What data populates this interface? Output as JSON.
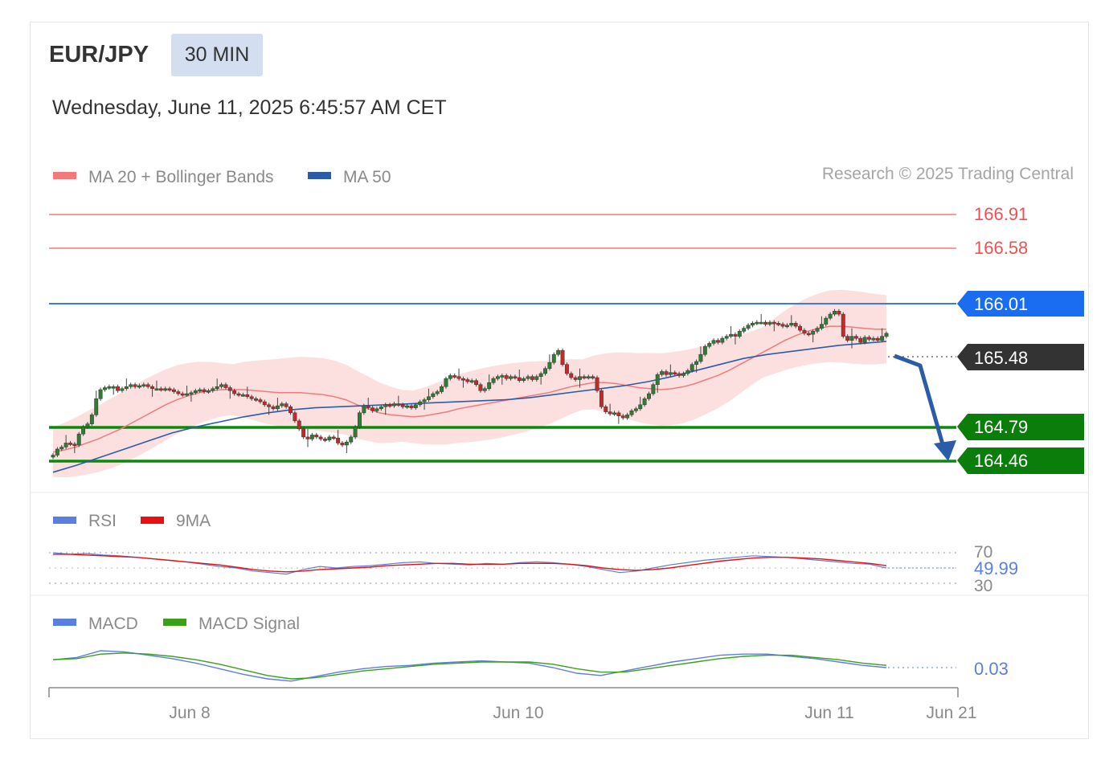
{
  "header": {
    "pair": "EUR/JPY",
    "timeframe": "30 MIN",
    "datetime": "Wednesday, June 11, 2025 6:45:57 AM CET",
    "copyright": "Research © 2025 Trading Central"
  },
  "legend": {
    "price": [
      {
        "label": "MA 20 + Bollinger Bands",
        "color": "#f47a7a"
      },
      {
        "label": "MA 50",
        "color": "#2a5ca8"
      }
    ],
    "rsi": [
      {
        "label": "RSI",
        "color": "#5b7fe0"
      },
      {
        "label": "9MA",
        "color": "#e81010"
      }
    ],
    "macd": [
      {
        "label": "MACD",
        "color": "#5b7fe0"
      },
      {
        "label": "MACD Signal",
        "color": "#3aa01a"
      }
    ]
  },
  "levels": [
    {
      "value": "166.91",
      "style": "resistance-text",
      "color": "#f05050"
    },
    {
      "value": "166.58",
      "style": "resistance-text",
      "color": "#f05050"
    },
    {
      "value": "166.01",
      "style": "pivot-badge",
      "color": "#1a6cf0"
    },
    {
      "value": "165.48",
      "style": "last-price-badge",
      "color": "#333333"
    },
    {
      "value": "164.79",
      "style": "support-badge",
      "color": "#0a7d0a"
    },
    {
      "value": "164.46",
      "style": "support-badge",
      "color": "#0a7d0a"
    }
  ],
  "rsi": {
    "ticks": [
      "70",
      "30"
    ],
    "current": "49.99"
  },
  "macd": {
    "current": "0.03"
  },
  "x_axis": {
    "labels": [
      "Jun 8",
      "Jun 10",
      "Jun 11",
      "Jun 21"
    ]
  },
  "chart_data": {
    "type": "candlestick",
    "ylim": [
      164.3,
      167.05
    ],
    "closes": [
      164.52,
      164.58,
      164.6,
      164.64,
      164.63,
      164.62,
      164.73,
      164.8,
      164.83,
      164.92,
      165.08,
      165.17,
      165.19,
      165.2,
      165.2,
      165.16,
      165.18,
      165.2,
      165.22,
      165.2,
      165.21,
      165.22,
      165.2,
      165.18,
      165.18,
      165.17,
      165.18,
      165.17,
      165.15,
      165.13,
      165.12,
      165.13,
      165.14,
      165.16,
      165.17,
      165.15,
      165.16,
      165.18,
      165.2,
      165.22,
      165.19,
      165.16,
      165.13,
      165.12,
      165.12,
      165.1,
      165.08,
      165.07,
      165.05,
      165.02,
      165,
      164.98,
      165.01,
      165.03,
      165.0,
      164.94,
      164.86,
      164.78,
      164.7,
      164.68,
      164.72,
      164.7,
      164.68,
      164.67,
      164.7,
      164.69,
      164.64,
      164.62,
      164.65,
      164.7,
      164.8,
      164.94,
      165.01,
      164.99,
      164.96,
      164.98,
      165,
      165.02,
      165.01,
      165.03,
      165.02,
      165,
      165.01,
      164.99,
      165.02,
      165.05,
      165.07,
      165.1,
      165.13,
      165.15,
      165.2,
      165.28,
      165.31,
      165.3,
      165.28,
      165.27,
      165.25,
      165.26,
      165.22,
      165.16,
      165.18,
      165.24,
      165.28,
      165.3,
      165.31,
      165.28,
      165.3,
      165.29,
      165.26,
      165.28,
      165.3,
      165.27,
      165.3,
      165.33,
      165.38,
      165.44,
      165.52,
      165.56,
      165.42,
      165.33,
      165.29,
      165.27,
      165.3,
      165.29,
      165.3,
      165.29,
      165.16,
      165.0,
      164.95,
      164.93,
      164.94,
      164.91,
      164.89,
      164.92,
      164.96,
      164.98,
      165.02,
      165.08,
      165.13,
      165.22,
      165.32,
      165.35,
      165.32,
      165.34,
      165.33,
      165.31,
      165.33,
      165.36,
      165.42,
      165.45,
      165.52,
      165.6,
      165.63,
      165.66,
      165.64,
      165.68,
      165.7,
      165.72,
      165.7,
      165.75,
      165.78,
      165.81,
      165.83,
      165.84,
      165.84,
      165.82,
      165.84,
      165.83,
      165.82,
      165.8,
      165.81,
      165.83,
      165.8,
      165.76,
      165.73,
      165.72,
      165.75,
      165.78,
      165.82,
      165.88,
      165.92,
      165.95,
      165.92,
      165.7,
      165.66,
      165.7,
      165.68,
      165.64,
      165.69,
      165.67,
      165.68,
      165.66,
      165.7,
      165.73
    ],
    "ma20": [
      164.55,
      164.57,
      164.6,
      164.64,
      164.68,
      164.73,
      164.78,
      164.84,
      164.9,
      164.96,
      165.02,
      165.07,
      165.11,
      165.14,
      165.16,
      165.17,
      165.17,
      165.17,
      165.16,
      165.15,
      165.14,
      165.14,
      165.14,
      165.13,
      165.12,
      165.1,
      165.07,
      165.02,
      164.98,
      164.94,
      164.92,
      164.91,
      164.9,
      164.91,
      164.93,
      164.95,
      164.98,
      165.0,
      165.02,
      165.04,
      165.06,
      165.08,
      165.1,
      165.12,
      165.14,
      165.17,
      165.2,
      165.22,
      165.24,
      165.24,
      165.23,
      165.21,
      165.19,
      165.18,
      165.17,
      165.18,
      165.2,
      165.23,
      165.27,
      165.31,
      165.36,
      165.42,
      165.48,
      165.54,
      165.6,
      165.66,
      165.71,
      165.75,
      165.78,
      165.8,
      165.8,
      165.79,
      165.78,
      165.77,
      165.77
    ],
    "ma50": [
      164.35,
      164.42,
      164.5,
      164.58,
      164.66,
      164.74,
      164.8,
      164.85,
      164.9,
      164.94,
      164.97,
      164.99,
      165.0,
      165.01,
      165.02,
      165.03,
      165.04,
      165.05,
      165.06,
      165.07,
      165.09,
      165.12,
      165.15,
      165.18,
      165.21,
      165.25,
      165.3,
      165.36,
      165.42,
      165.48,
      165.52,
      165.55,
      165.58,
      165.61,
      165.63,
      165.65
    ],
    "rsi": [
      70,
      68,
      69,
      67,
      66,
      64,
      62,
      60,
      58,
      55,
      52,
      50,
      46,
      44,
      42,
      48,
      52,
      50,
      52,
      53,
      55,
      57,
      58,
      56,
      55,
      54,
      56,
      55,
      57,
      58,
      57,
      55,
      52,
      48,
      44,
      46,
      50,
      54,
      57,
      60,
      62,
      64,
      66,
      65,
      64,
      62,
      60,
      58,
      56,
      55,
      50
    ],
    "rsi_ma9": [
      68,
      68,
      67,
      66,
      65,
      64,
      62,
      60,
      58,
      56,
      54,
      51,
      48,
      46,
      45,
      46,
      48,
      49,
      50,
      51,
      53,
      54,
      55,
      56,
      56,
      55,
      55,
      55,
      56,
      56,
      56,
      55,
      53,
      50,
      48,
      47,
      48,
      50,
      53,
      56,
      59,
      61,
      63,
      64,
      64,
      63,
      62,
      60,
      58,
      56,
      53
    ],
    "macd": [
      0.1,
      0.12,
      0.18,
      0.17,
      0.14,
      0.11,
      0.07,
      0.02,
      -0.03,
      -0.07,
      -0.09,
      -0.05,
      -0.01,
      0.02,
      0.04,
      0.05,
      0.07,
      0.08,
      0.09,
      0.08,
      0.07,
      0.03,
      -0.02,
      -0.04,
      0.0,
      0.04,
      0.08,
      0.11,
      0.14,
      0.15,
      0.15,
      0.13,
      0.11,
      0.08,
      0.05,
      0.03
    ],
    "macd_signal": [
      0.1,
      0.11,
      0.15,
      0.16,
      0.15,
      0.13,
      0.1,
      0.06,
      0.01,
      -0.04,
      -0.07,
      -0.06,
      -0.03,
      0.0,
      0.02,
      0.04,
      0.06,
      0.07,
      0.08,
      0.08,
      0.08,
      0.06,
      0.02,
      -0.01,
      -0.01,
      0.02,
      0.05,
      0.08,
      0.11,
      0.13,
      0.14,
      0.14,
      0.12,
      0.1,
      0.07,
      0.05
    ]
  }
}
